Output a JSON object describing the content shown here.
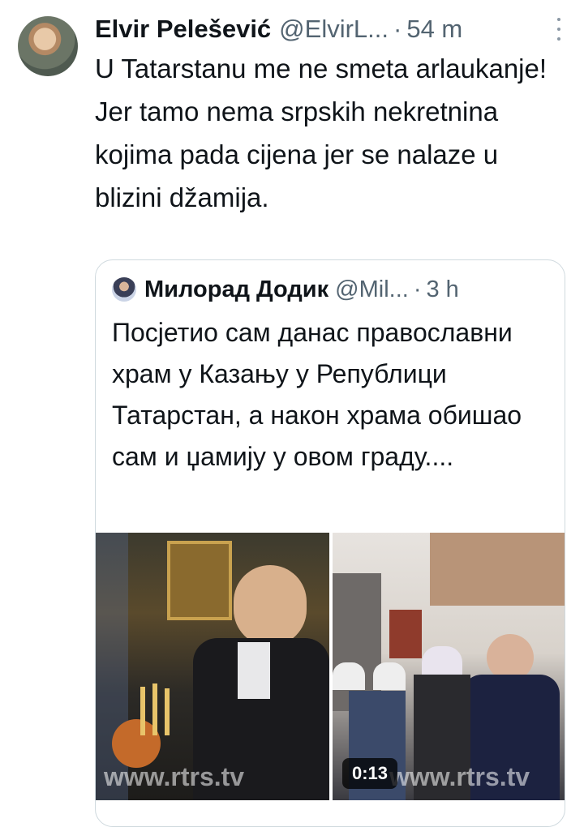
{
  "tweet": {
    "author_name": "Elvir Pelešević",
    "handle": "@ElvirL...",
    "separator": "·",
    "time": "54 m",
    "text": "U Tatarstanu me ne smeta arlaukanje! Jer tamo nema srpskih nekretnina kojima pada cijena jer se nalaze u blizini džamija."
  },
  "quoted_tweet": {
    "author_name": "Милорад Додик",
    "handle": "@Mil...",
    "separator": "·",
    "time": "3 h",
    "text": "Посјетио сам данас православни храм у Казању у Републици Татарстан, а након храма обишао сам и џамију у овом граду....",
    "media": {
      "image1_watermark": "www.rtrs.tv",
      "image2_watermark": "www.rtrs.tv",
      "video_duration": "0:13"
    }
  },
  "icons": [
    "more-icon"
  ]
}
